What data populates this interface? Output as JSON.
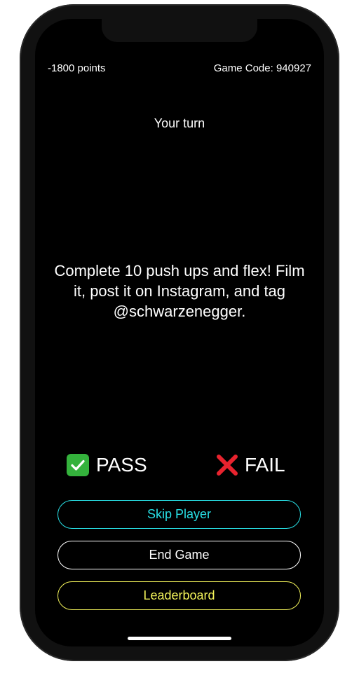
{
  "status": {
    "points": "-1800 points",
    "game_code": "Game Code: 940927"
  },
  "turn": {
    "label": "Your turn"
  },
  "challenge": {
    "text": "Complete 10 push ups and flex! Film it, post it on Instagram, and tag @schwarzenegger."
  },
  "verdict": {
    "pass_label": "PASS",
    "pass_icon": "check-mark-icon",
    "fail_label": "FAIL",
    "fail_icon": "cross-mark-icon"
  },
  "actions": {
    "skip_label": "Skip Player",
    "end_label": "End Game",
    "leaderboard_label": "Leaderboard"
  },
  "colors": {
    "skip": "#28e0e6",
    "end": "#ffffff",
    "leaderboard": "#f3f35a",
    "pass_icon_bg": "#34b23c",
    "fail_icon": "#e8232e"
  }
}
